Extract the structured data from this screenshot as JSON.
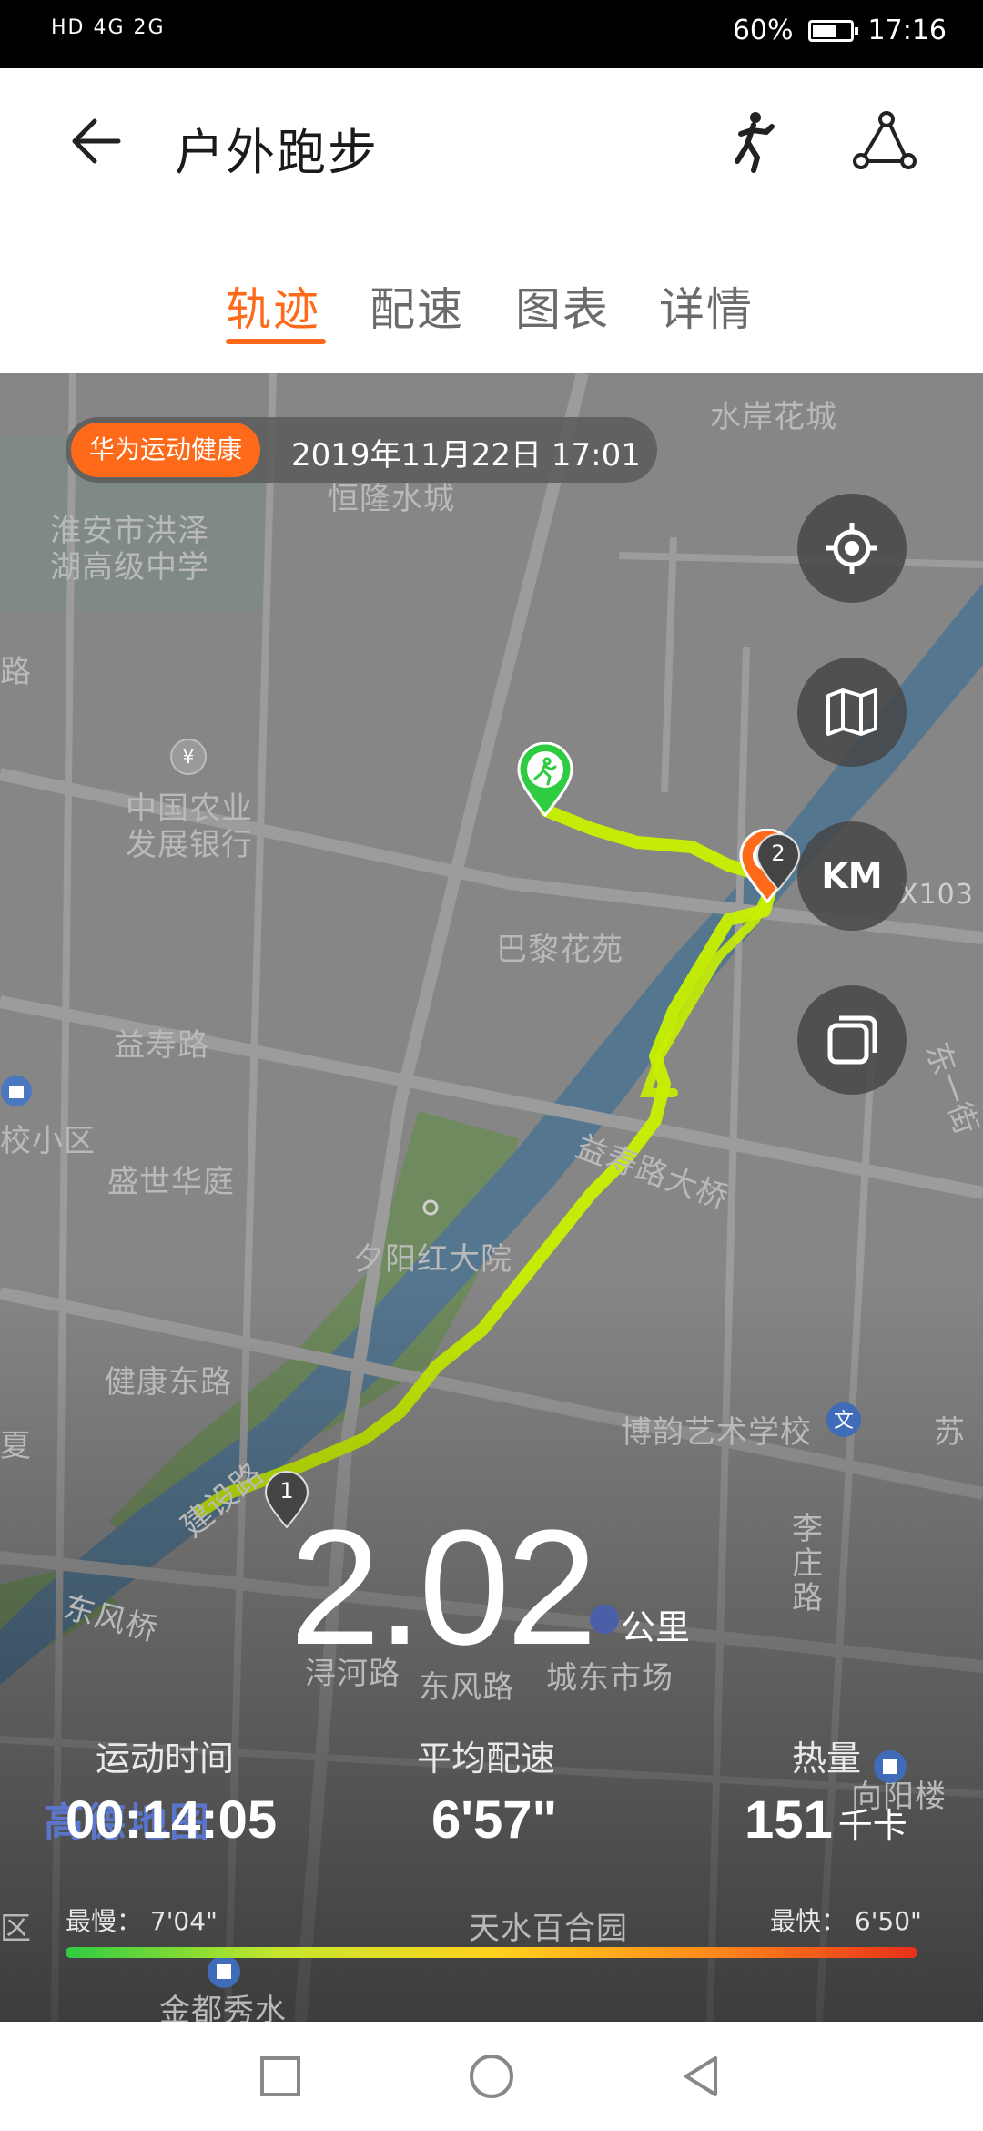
{
  "status_bar": {
    "left": "HD 4G 2G",
    "battery": "60%",
    "time": "17:16"
  },
  "header": {
    "title": "户外跑步",
    "back_icon": "arrow-left-icon",
    "icons": [
      "runner-icon",
      "route-share-icon"
    ]
  },
  "tabs": [
    {
      "label": "轨迹",
      "active": true
    },
    {
      "label": "配速",
      "active": false
    },
    {
      "label": "图表",
      "active": false
    },
    {
      "label": "详情",
      "active": false
    }
  ],
  "map": {
    "brand_badge": "华为运动健康",
    "date": "2019年11月22日 17:01",
    "buttons": {
      "locate": "crosshair-icon",
      "map_type": "map-icon",
      "unit": "KM",
      "layers": "layers-icon"
    },
    "labels": [
      "水岸花城",
      "恒隆水城",
      "淮安市洪泽",
      "湖高级中学",
      "路",
      "中国农业",
      "发展银行",
      "X103",
      "巴黎花苑",
      "益寿路",
      "校小区",
      "东一街",
      "益寿路大桥",
      "盛世华庭",
      "夕阳红大院",
      "健康东路",
      "博韵艺术学校",
      "苏",
      "夏",
      "建设路",
      "李庄路",
      "东风桥",
      "浔河路",
      "东风路",
      "城东市场",
      "向阳楼",
      "天水百合园",
      "金都秀水",
      "区"
    ],
    "watermark": "高德地图",
    "km_markers": [
      "1",
      "2"
    ],
    "accent_colors": {
      "route": "#c8f000",
      "brand": "#ff6a1a",
      "start": "#2ecc40"
    }
  },
  "summary": {
    "distance": "2.02",
    "distance_unit": "公里",
    "duration_label": "运动时间",
    "duration": "00:14:05",
    "pace_label": "平均配速",
    "pace": "6'57\"",
    "calories_label": "热量",
    "calories": "151",
    "calories_unit": "千卡",
    "slowest": "最慢：  7'04\"",
    "fastest": "最快：  6'50\""
  },
  "nav": [
    "recent-apps-icon",
    "home-icon",
    "back-icon"
  ]
}
